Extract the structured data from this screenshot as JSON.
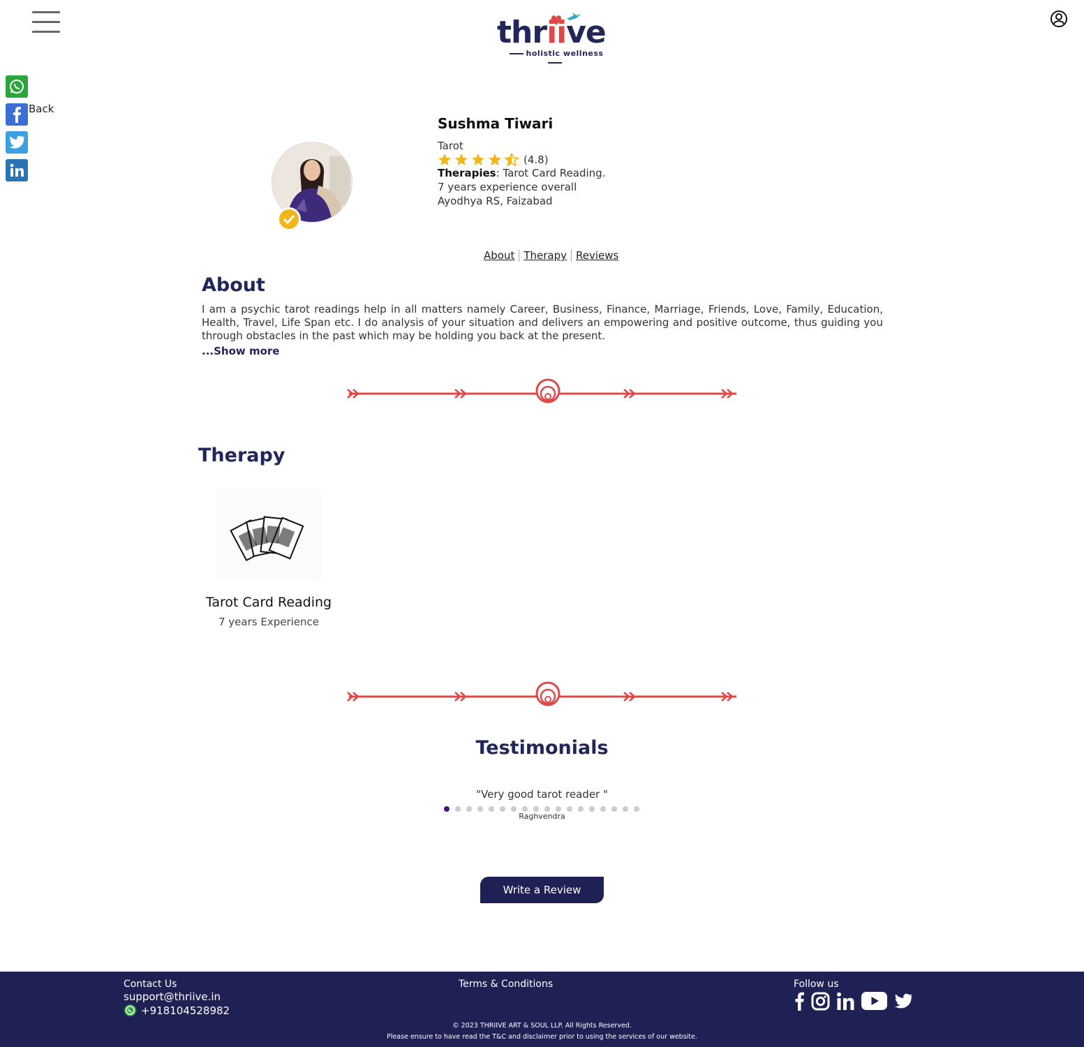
{
  "brand": {
    "name_prefix": "thr",
    "name_ii": "ii",
    "name_suffix": "ve",
    "tagline": "holistic wellness"
  },
  "nav": {
    "back_label": "Back"
  },
  "profile": {
    "name": "Sushma Tiwari",
    "category": "Tarot",
    "rating": 4.5,
    "rating_text": "(4.8)",
    "therapies_label": "Therapies",
    "therapies_value": ": Tarot Card Reading.",
    "experience": "7 years experience overall",
    "location": "Ayodhya RS, Faizabad"
  },
  "tabs": [
    "About",
    "Therapy",
    "Reviews"
  ],
  "about": {
    "title": "About",
    "text": "I am a psychic tarot readings help in all matters namely Career, Business, Finance, Marriage, Friends, Love, Family, Education, Health, Travel, Life Span etc. I do analysis of your situation and delivers an empowering and positive outcome, thus guiding you through obstacles in the past which may be holding you back at the present.",
    "show_more": "...Show more"
  },
  "therapy": {
    "title": "Therapy",
    "cards": [
      {
        "name": "Tarot Card Reading",
        "experience": "7 years Experience"
      }
    ]
  },
  "testimonials": {
    "title": "Testimonials",
    "quote": "\"Very good tarot reader \"",
    "reviewer": "Raghvendra",
    "dot_count": 18,
    "active_dot": 0
  },
  "review_button": "Write a Review",
  "footer": {
    "contact_label": "Contact Us",
    "email": "support@thriive.in",
    "phone": "+918104528982",
    "terms": "Terms & Conditions",
    "follow": "Follow us",
    "copyright": "© 2023 THRIIVE ART & SOUL LLP. All Rights Reserved.",
    "disclaimer": "Please ensure to have read the T&C and disclaimer prior to using the services of our website."
  },
  "colors": {
    "brand_navy": "#1f2155",
    "accent_red": "#e04848",
    "star": "#f2b51a",
    "active_dot": "#4a1480"
  }
}
